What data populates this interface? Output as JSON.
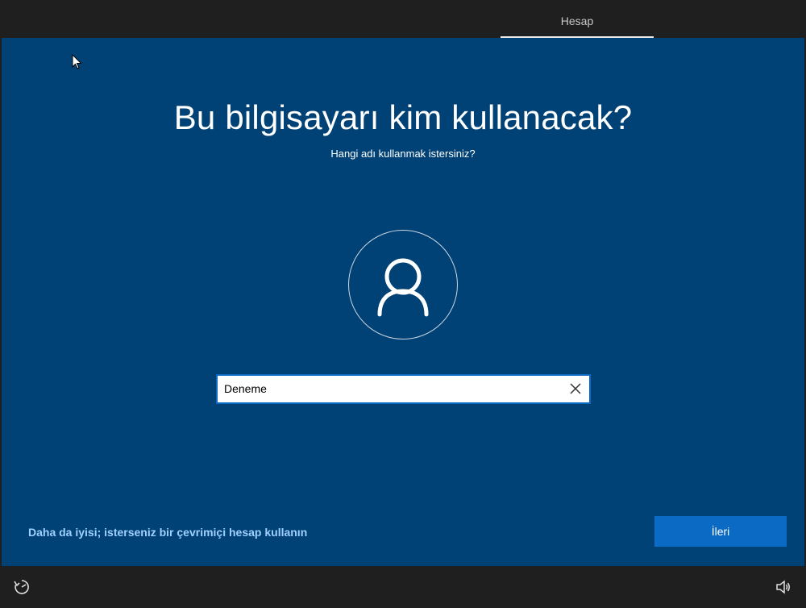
{
  "header": {
    "tab_label": "Hesap"
  },
  "main": {
    "title": "Bu bilgisayarı kim kullanacak?",
    "subtitle": "Hangi adı kullanmak istersiniz?",
    "name_field": {
      "value": "Deneme"
    },
    "online_account_link": "Daha da iyisi; isterseniz bir çevrimiçi hesap kullanın",
    "next_button_label": "İleri"
  },
  "icons": {
    "avatar": "user-icon",
    "clear": "close-icon",
    "ease_of_access": "ease-of-access-icon",
    "volume": "volume-icon",
    "cursor": "mouse-pointer-icon"
  },
  "colors": {
    "background": "#004275",
    "accent": "#0a6ac4",
    "link": "#9fd0ff",
    "bar": "#1f1f1f"
  }
}
